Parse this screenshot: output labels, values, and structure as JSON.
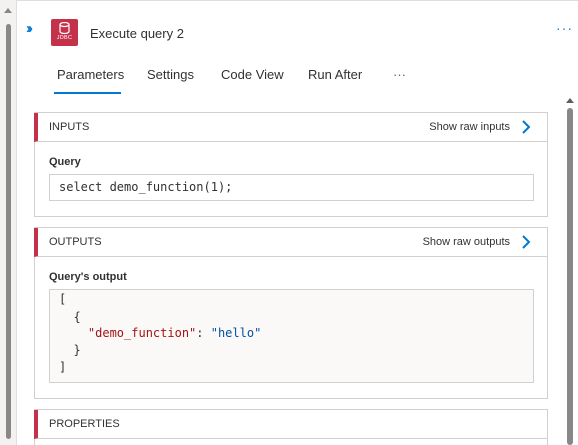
{
  "header": {
    "title": "Execute query 2",
    "icon_text": "JDBC",
    "more_label": "···"
  },
  "tabs": [
    {
      "label": "Parameters",
      "active": true
    },
    {
      "label": "Settings"
    },
    {
      "label": "Code View"
    },
    {
      "label": "Run After"
    },
    {
      "label": "···"
    }
  ],
  "inputs": {
    "title": "INPUTS",
    "raw_label": "Show raw inputs",
    "field_label": "Query",
    "query_value": "select demo_function(1);"
  },
  "outputs": {
    "title": "OUTPUTS",
    "raw_label": "Show raw outputs",
    "field_label": "Query's output",
    "lines": {
      "l1": "[",
      "l2": "  {",
      "l3_key": "\"demo_function\"",
      "l3_sep": ": ",
      "l3_val": "\"hello\"",
      "l4": "  }",
      "l5": "]"
    }
  },
  "properties": {
    "title": "PROPERTIES"
  },
  "colors": {
    "accent": "#0078d4",
    "section_marker": "#c4314b",
    "json_key": "#a31515",
    "json_string": "#0451a5"
  }
}
